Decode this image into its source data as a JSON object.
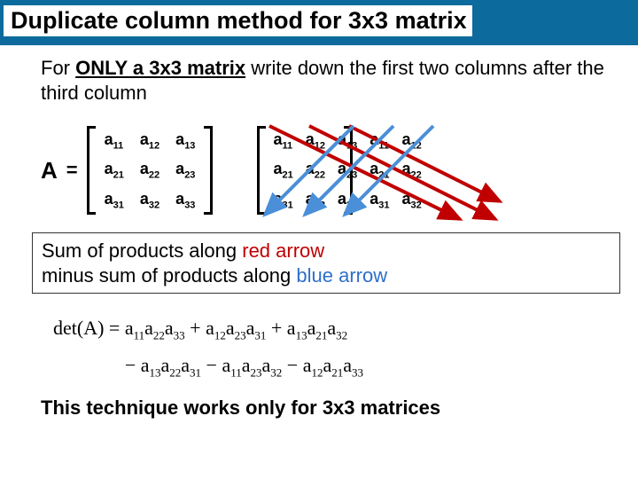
{
  "title": "Duplicate column method for 3x3 matrix",
  "intro": {
    "prefix": "For ",
    "emph": "ONLY a 3x3 matrix",
    "rest": " write down the first two columns after the third column"
  },
  "matrix": {
    "label": "A",
    "eq": "=",
    "cells": {
      "a11": "a",
      "s11": "11",
      "a12": "a",
      "s12": "12",
      "a13": "a",
      "s13": "13",
      "a21": "a",
      "s21": "21",
      "a22": "a",
      "s22": "22",
      "a23": "a",
      "s23": "23",
      "a31": "a",
      "s31": "31",
      "a32": "a",
      "s32": "32",
      "a33": "a",
      "s33": "33"
    }
  },
  "sumbox": {
    "l1a": "Sum of products along ",
    "l1b": "red arrow",
    "l2a": "minus sum of products along ",
    "l2b": "blue arrow"
  },
  "formula": {
    "lhs": "det(A) = ",
    "t1a": "a",
    "t1s1": "11",
    "t1b": "a",
    "t1s2": "22",
    "t1c": "a",
    "t1s3": "33",
    "p1": " + ",
    "t2a": "a",
    "t2s1": "12",
    "t2b": "a",
    "t2s2": "23",
    "t2c": "a",
    "t2s3": "31",
    "p2": " + ",
    "t3a": "a",
    "t3s1": "13",
    "t3b": "a",
    "t3s2": "21",
    "t3c": "a",
    "t3s3": "32",
    "m1": "− ",
    "t4a": "a",
    "t4s1": "13",
    "t4b": "a",
    "t4s2": "22",
    "t4c": "a",
    "t4s3": "31",
    "m2": " − ",
    "t5a": "a",
    "t5s1": "11",
    "t5b": "a",
    "t5s2": "23",
    "t5c": "a",
    "t5s3": "32",
    "m3": " − ",
    "t6a": "a",
    "t6s1": "12",
    "t6b": "a",
    "t6s2": "21",
    "t6c": "a",
    "t6s3": "33"
  },
  "footer": "This technique works only for 3x3 matrices"
}
